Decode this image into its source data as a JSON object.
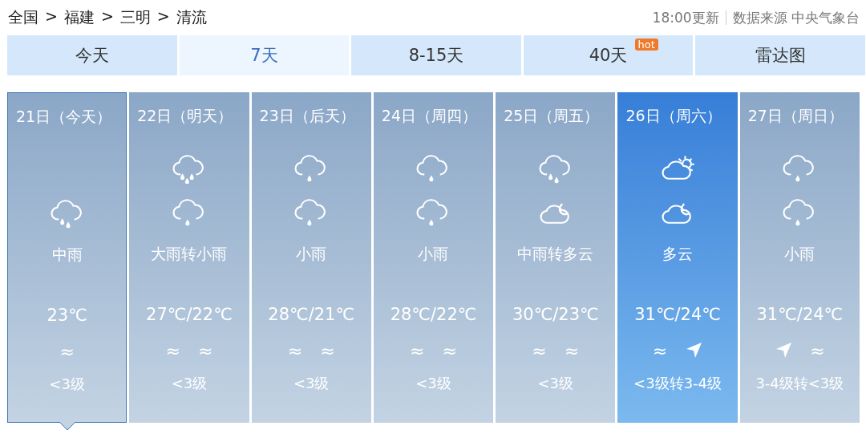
{
  "breadcrumb": [
    "全国",
    "福建",
    "三明",
    "清流"
  ],
  "breadcrumb_separator": ">",
  "update_time": "18:00更新",
  "source": "数据来源 中央气象台",
  "tabs": [
    {
      "label": "今天",
      "selected": false
    },
    {
      "label": "7天",
      "selected": true
    },
    {
      "label": "8-15天",
      "selected": false
    },
    {
      "label": "40天",
      "selected": false,
      "badge": "hot"
    },
    {
      "label": "雷达图",
      "selected": false
    }
  ],
  "days": [
    {
      "date": "21日（今天）",
      "selected": true,
      "highlighted": false,
      "icons": [
        {
          "kind": "rain_moderate"
        }
      ],
      "weather": "中雨",
      "temperature": "23℃",
      "wind": [
        {
          "kind": "calm",
          "text": "≈"
        }
      ],
      "wind_level": "<3级"
    },
    {
      "date": "22日（明天）",
      "selected": false,
      "highlighted": false,
      "icons": [
        {
          "kind": "rain_heavy"
        },
        {
          "kind": "rain_light"
        }
      ],
      "weather": "大雨转小雨",
      "temperature": "27℃/22℃",
      "wind": [
        {
          "kind": "calm",
          "text": "≈"
        },
        {
          "kind": "calm",
          "text": "≈"
        }
      ],
      "wind_level": "<3级"
    },
    {
      "date": "23日（后天）",
      "selected": false,
      "highlighted": false,
      "icons": [
        {
          "kind": "rain_light"
        },
        {
          "kind": "rain_light"
        }
      ],
      "weather": "小雨",
      "temperature": "28℃/21℃",
      "wind": [
        {
          "kind": "calm",
          "text": "≈"
        },
        {
          "kind": "calm",
          "text": "≈"
        }
      ],
      "wind_level": "<3级"
    },
    {
      "date": "24日（周四）",
      "selected": false,
      "highlighted": false,
      "icons": [
        {
          "kind": "rain_light"
        },
        {
          "kind": "rain_light"
        }
      ],
      "weather": "小雨",
      "temperature": "28℃/22℃",
      "wind": [
        {
          "kind": "calm",
          "text": "≈"
        },
        {
          "kind": "calm",
          "text": "≈"
        }
      ],
      "wind_level": "<3级"
    },
    {
      "date": "25日（周五）",
      "selected": false,
      "highlighted": false,
      "icons": [
        {
          "kind": "rain_moderate"
        },
        {
          "kind": "cloudy_night"
        }
      ],
      "weather": "中雨转多云",
      "temperature": "30℃/23℃",
      "wind": [
        {
          "kind": "calm",
          "text": "≈"
        },
        {
          "kind": "calm",
          "text": "≈"
        }
      ],
      "wind_level": "<3级"
    },
    {
      "date": "26日（周六）",
      "selected": false,
      "highlighted": true,
      "icons": [
        {
          "kind": "cloudy_day"
        },
        {
          "kind": "cloudy_night"
        }
      ],
      "weather": "多云",
      "temperature": "31℃/24℃",
      "wind": [
        {
          "kind": "calm",
          "text": "≈"
        },
        {
          "kind": "direction"
        }
      ],
      "wind_level": "<3级转3-4级"
    },
    {
      "date": "27日（周日）",
      "selected": false,
      "highlighted": false,
      "icons": [
        {
          "kind": "rain_light"
        },
        {
          "kind": "rain_light"
        }
      ],
      "weather": "小雨",
      "temperature": "31℃/24℃",
      "wind": [
        {
          "kind": "direction"
        },
        {
          "kind": "calm",
          "text": "≈"
        }
      ],
      "wind_level": "3-4级转<3级"
    }
  ]
}
